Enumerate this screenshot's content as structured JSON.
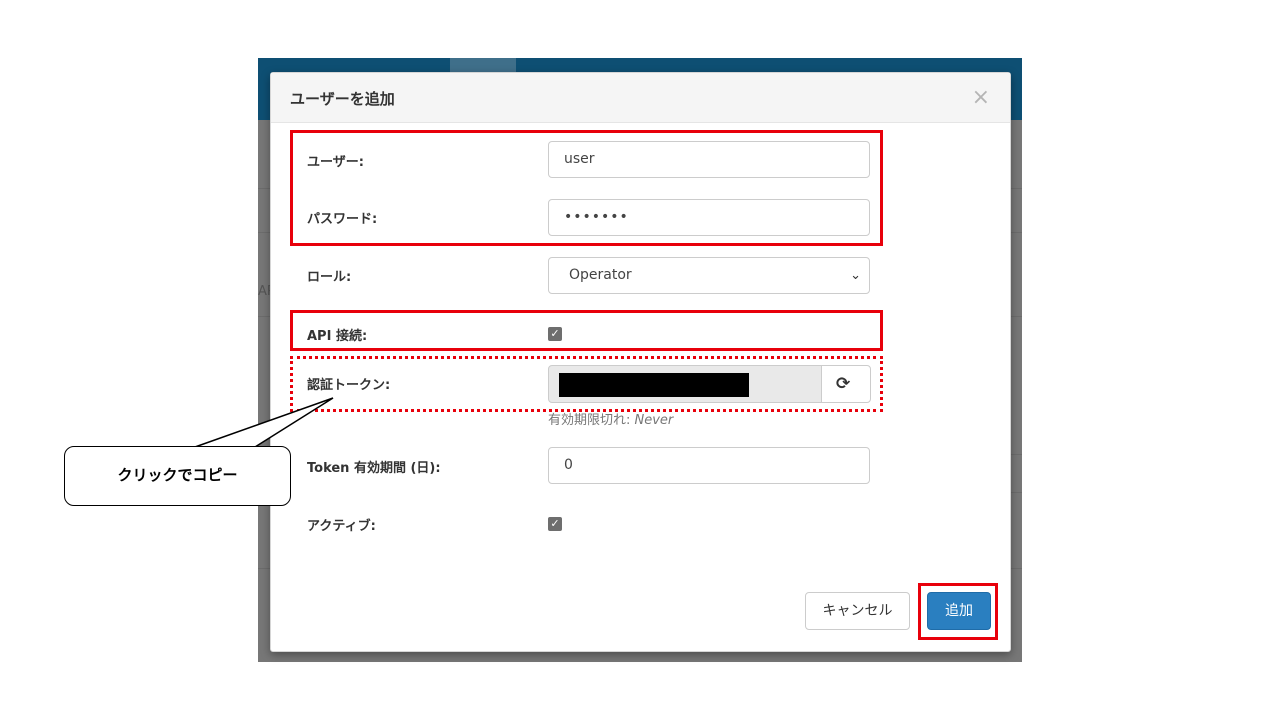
{
  "dialog": {
    "title": "ユーザーを追加",
    "close_glyph": "×",
    "fields": {
      "user": {
        "label": "ユーザー:",
        "value": "user"
      },
      "password": {
        "label": "パスワード:",
        "value": "•••••••"
      },
      "role": {
        "label": "ロール:",
        "value": "Operator",
        "chevron": "⌄"
      },
      "api": {
        "label": "API 接続:",
        "checked": true,
        "check_glyph": "✓"
      },
      "token": {
        "label": "認証トークン:",
        "help_prefix": "有効期限切れ: ",
        "help_value": "Never",
        "refresh_glyph": "⟳"
      },
      "token_days": {
        "label": "Token 有効期間 (日):",
        "value": "0"
      },
      "active": {
        "label": "アクティブ:",
        "checked": true,
        "check_glyph": "✓"
      }
    },
    "buttons": {
      "cancel": "キャンセル",
      "add": "追加"
    }
  },
  "annotation": {
    "callout": "クリックでコピー",
    "highlight_color": "#e8000b"
  },
  "background_app": {
    "nav_color": "#0e4f73",
    "fragment": "AP"
  },
  "colors": {
    "primary_button": "#2a7fc0"
  }
}
